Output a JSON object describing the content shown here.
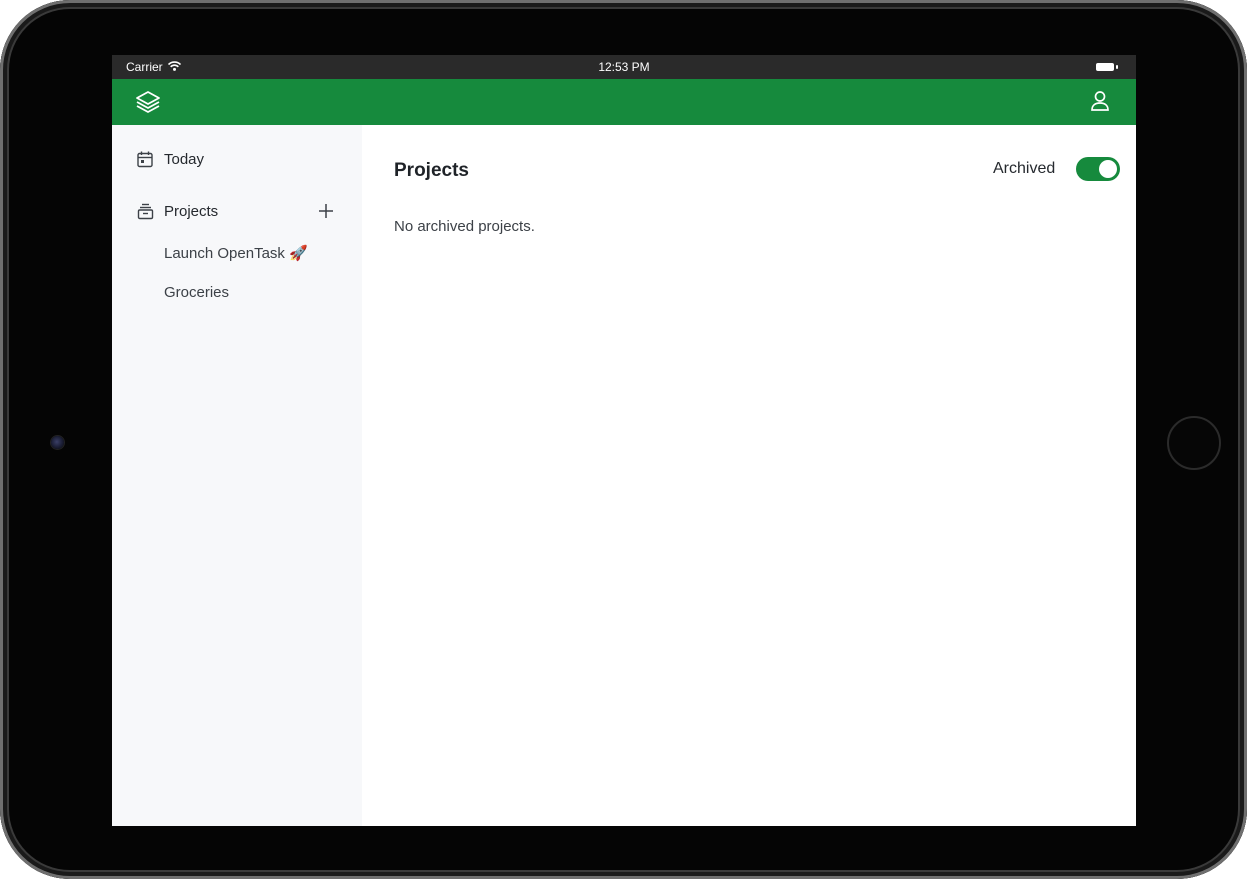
{
  "status_bar": {
    "carrier": "Carrier",
    "time": "12:53 PM",
    "wifi_icon": "wifi-icon",
    "battery_icon": "battery-icon"
  },
  "app_bar": {
    "logo_icon": "layers-icon",
    "account_icon": "user-icon",
    "color": "#168a3d"
  },
  "sidebar": {
    "today_label": "Today",
    "today_icon": "calendar-icon",
    "projects_label": "Projects",
    "projects_icon": "inbox-stack-icon",
    "add_icon": "plus-icon",
    "projects": [
      {
        "label": "Launch OpenTask 🚀"
      },
      {
        "label": "Groceries"
      }
    ]
  },
  "main": {
    "title": "Projects",
    "archived_label": "Archived",
    "archived_toggle_on": true,
    "empty_message": "No archived projects."
  },
  "colors": {
    "accent": "#168a3d",
    "sidebar_bg": "#f7f8fa",
    "status_bar_bg": "#2a2a2a"
  }
}
